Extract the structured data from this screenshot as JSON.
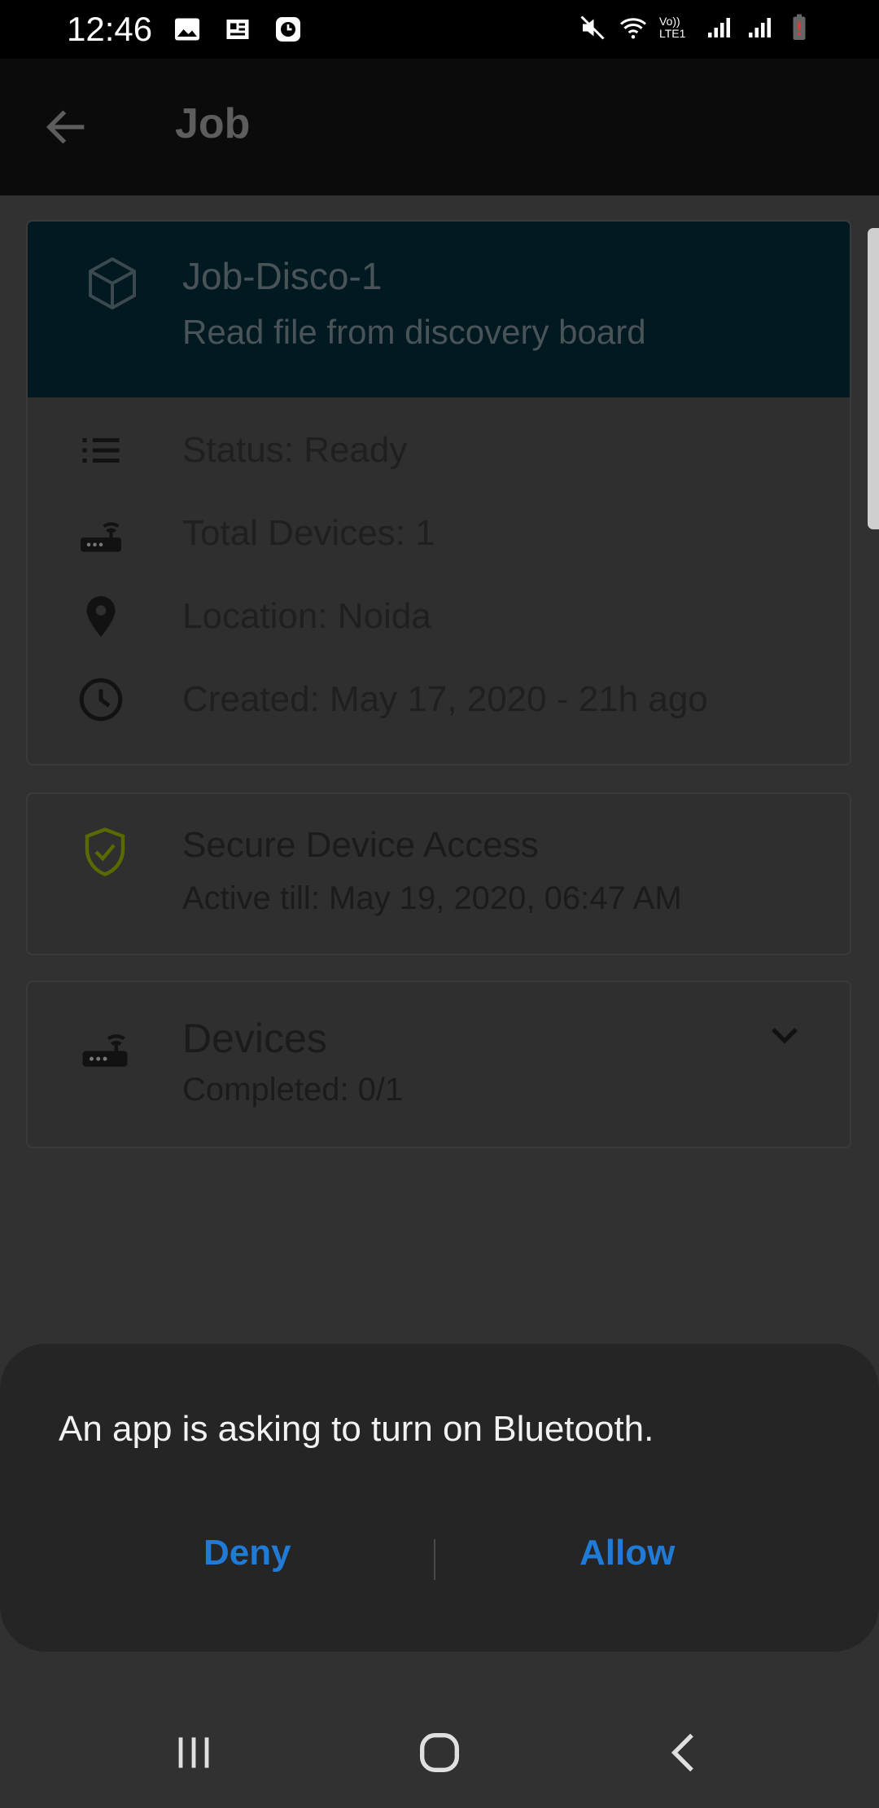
{
  "status_bar": {
    "time": "12:46",
    "icons_left": [
      "image-icon",
      "news-icon",
      "clock-app-icon"
    ],
    "icons_right": [
      "mute-icon",
      "wifi-icon",
      "volte-icon",
      "signal-icon",
      "signal-icon",
      "battery-low-icon"
    ],
    "volte_label": "Vo)) LTE1"
  },
  "app_bar": {
    "title": "Job"
  },
  "job_card": {
    "name": "Job-Disco-1",
    "description": "Read file from discovery board",
    "status": "Status: Ready",
    "total_devices": "Total Devices: 1",
    "location": "Location: Noida",
    "created": "Created: May 17, 2020 - 21h ago"
  },
  "secure_card": {
    "title": "Secure Device Access",
    "subtitle": "Active till: May 19, 2020, 06:47 AM"
  },
  "devices_card": {
    "title": "Devices",
    "subtitle": "Completed: 0/1"
  },
  "dialog": {
    "message": "An app is asking to turn on Bluetooth.",
    "deny_label": "Deny",
    "allow_label": "Allow"
  },
  "colors": {
    "accent": "#1f7bd6",
    "header_bg": "#011a22",
    "shield": "#5a6a00"
  }
}
